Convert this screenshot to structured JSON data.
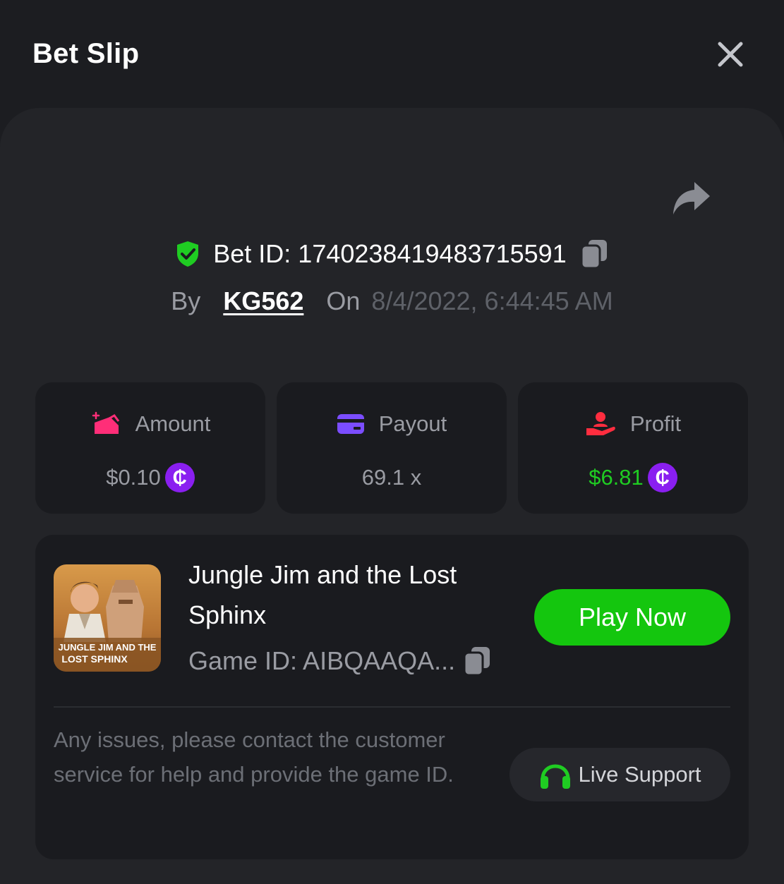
{
  "header": {
    "title": "Bet Slip",
    "close_icon": "close-icon"
  },
  "bet": {
    "id_label": "Bet ID: 1740238419483715591",
    "by_label": "By",
    "username": "KG562",
    "on_label": "On",
    "date": "8/4/2022, 6:44:45 AM"
  },
  "stats": {
    "amount": {
      "label": "Amount",
      "value": "$0.10",
      "icon": "ticket-icon"
    },
    "payout": {
      "label": "Payout",
      "value": "69.1 x",
      "icon": "card-icon"
    },
    "profit": {
      "label": "Profit",
      "value": "$6.81",
      "icon": "hand-user-icon"
    },
    "coin_symbol": "₵"
  },
  "game": {
    "name": "Jungle Jim and the Lost Sphinx",
    "thumb_title_line1": "JUNGLE JIM AND THE",
    "thumb_title_line2": "LOST SPHINX",
    "game_id": "Game ID: AIBQAAQA...",
    "play_label": "Play Now"
  },
  "support": {
    "help_text": "Any issues, please contact the customer service for help and provide the game ID.",
    "live_label": "Live Support"
  },
  "colors": {
    "background": "#1c1d21",
    "panel": "#232428",
    "card": "#1a1b1f",
    "accent_green": "#14c60e",
    "profit_green": "#1fcc22",
    "coin_purple": "#8a1ff0",
    "amount_pink": "#ff2e78",
    "payout_purple": "#7b4dff",
    "profit_red": "#ff2d3f"
  }
}
